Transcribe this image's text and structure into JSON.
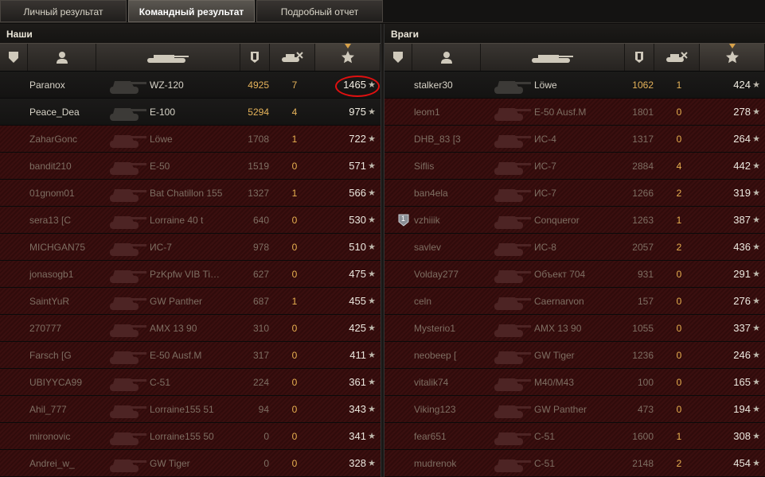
{
  "tabs": [
    "Личный результат",
    "Командный результат",
    "Подробный отчет"
  ],
  "active_tab": 1,
  "teams": {
    "allies": {
      "title": "Наши",
      "rows": [
        {
          "player": "Paranox",
          "tank": "WZ-120",
          "damage": "4925",
          "kills": "7",
          "xp": "1465",
          "alive": true
        },
        {
          "player": "Peace_Dea",
          "tank": "E-100",
          "damage": "5294",
          "kills": "4",
          "xp": "975",
          "alive": true
        },
        {
          "player": "ZaharGonc",
          "tank": "Löwe",
          "damage": "1708",
          "kills": "1",
          "xp": "722",
          "alive": false
        },
        {
          "player": "bandit210",
          "tank": "E-50",
          "damage": "1519",
          "kills": "0",
          "xp": "571",
          "alive": false
        },
        {
          "player": "01gnom01",
          "tank": "Bat Chatillon 155",
          "damage": "1327",
          "kills": "1",
          "xp": "566",
          "alive": false
        },
        {
          "player": "sera13 [C",
          "tank": "Lorraine 40 t",
          "damage": "640",
          "kills": "0",
          "xp": "530",
          "alive": false
        },
        {
          "player": "MICHGAN75",
          "tank": "ИС-7",
          "damage": "978",
          "kills": "0",
          "xp": "510",
          "alive": false
        },
        {
          "player": "jonasogb1",
          "tank": "PzKpfw VIB Tiger II",
          "damage": "627",
          "kills": "0",
          "xp": "475",
          "alive": false
        },
        {
          "player": "SaintYuR",
          "tank": "GW Panther",
          "damage": "687",
          "kills": "1",
          "xp": "455",
          "alive": false
        },
        {
          "player": "270777",
          "tank": "AMX 13 90",
          "damage": "310",
          "kills": "0",
          "xp": "425",
          "alive": false
        },
        {
          "player": "Farsch [G",
          "tank": "E-50 Ausf.M",
          "damage": "317",
          "kills": "0",
          "xp": "411",
          "alive": false
        },
        {
          "player": "UBIYYCA99",
          "tank": "С-51",
          "damage": "224",
          "kills": "0",
          "xp": "361",
          "alive": false
        },
        {
          "player": "Ahil_777",
          "tank": "Lorraine155 51",
          "damage": "94",
          "kills": "0",
          "xp": "343",
          "alive": false
        },
        {
          "player": "mironovic",
          "tank": "Lorraine155 50",
          "damage": "0",
          "kills": "0",
          "xp": "341",
          "alive": false
        },
        {
          "player": "Andrei_w_",
          "tank": "GW Tiger",
          "damage": "0",
          "kills": "0",
          "xp": "328",
          "alive": false
        }
      ]
    },
    "enemies": {
      "title": "Враги",
      "rows": [
        {
          "player": "stalker30",
          "tank": "Löwe",
          "damage": "1062",
          "kills": "1",
          "xp": "424",
          "alive": true
        },
        {
          "player": "leom1",
          "tank": "E-50 Ausf.M",
          "damage": "1801",
          "kills": "0",
          "xp": "278",
          "alive": false
        },
        {
          "player": "DHB_83 [3",
          "tank": "ИС-4",
          "damage": "1317",
          "kills": "0",
          "xp": "264",
          "alive": false
        },
        {
          "player": "Siflis",
          "tank": "ИС-7",
          "damage": "2884",
          "kills": "4",
          "xp": "442",
          "alive": false
        },
        {
          "player": "ban4ela",
          "tank": "ИС-7",
          "damage": "1266",
          "kills": "2",
          "xp": "319",
          "alive": false
        },
        {
          "player": "vzhiiik",
          "tank": "Conqueror",
          "damage": "1263",
          "kills": "1",
          "xp": "387",
          "alive": false,
          "badge": "1"
        },
        {
          "player": "savlev",
          "tank": "ИС-8",
          "damage": "2057",
          "kills": "2",
          "xp": "436",
          "alive": false
        },
        {
          "player": "Volday277",
          "tank": "Объект 704",
          "damage": "931",
          "kills": "0",
          "xp": "291",
          "alive": false
        },
        {
          "player": "celn",
          "tank": "Caernarvon",
          "damage": "157",
          "kills": "0",
          "xp": "276",
          "alive": false
        },
        {
          "player": "Mysterio1",
          "tank": "AMX 13 90",
          "damage": "1055",
          "kills": "0",
          "xp": "337",
          "alive": false
        },
        {
          "player": "neobeep [",
          "tank": "GW Tiger",
          "damage": "1236",
          "kills": "0",
          "xp": "246",
          "alive": false
        },
        {
          "player": "vitalik74",
          "tank": "M40/M43",
          "damage": "100",
          "kills": "0",
          "xp": "165",
          "alive": false
        },
        {
          "player": "Viking123",
          "tank": "GW Panther",
          "damage": "473",
          "kills": "0",
          "xp": "194",
          "alive": false
        },
        {
          "player": "fear651",
          "tank": "С-51",
          "damage": "1600",
          "kills": "1",
          "xp": "308",
          "alive": false
        },
        {
          "player": "mudrenok",
          "tank": "С-51",
          "damage": "2148",
          "kills": "2",
          "xp": "454",
          "alive": false
        }
      ]
    }
  },
  "columns": [
    "badge-icon",
    "player-icon",
    "tank-icon",
    "damage-icon",
    "kills-icon",
    "xp-star-icon"
  ],
  "sorted_column": "xp-star-icon",
  "highlighted_value": "1465",
  "colors": {
    "highlight_circle": "#e01010",
    "damage_gold": "#e6b35a",
    "dead_row": "#3a0f0f"
  }
}
